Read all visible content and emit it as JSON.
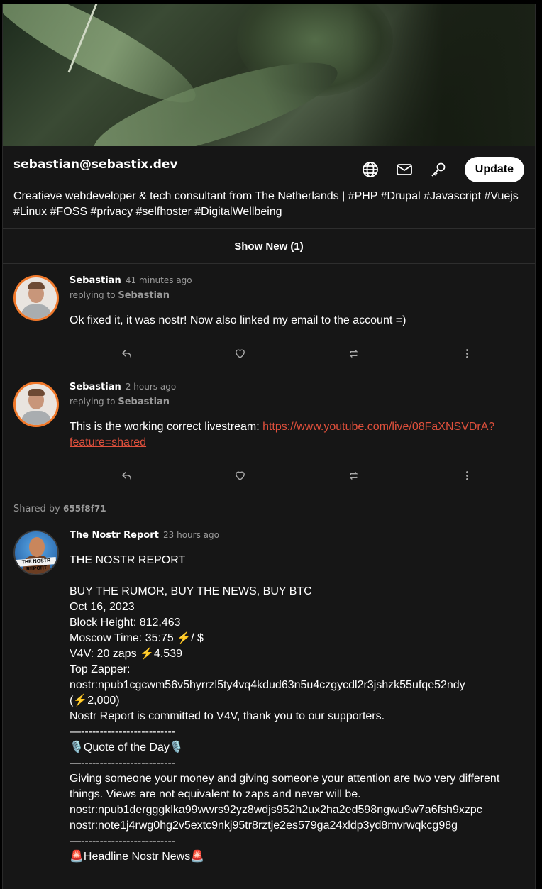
{
  "profile": {
    "name": "sebastian@sebastix.dev",
    "bio": "Creatieve webdeveloper & tech consultant from The Netherlands | #PHP #Drupal #Javascript #Vuejs #Linux #FOSS #privacy #selfhoster #DigitalWellbeing",
    "update_label": "Update",
    "icons": [
      "globe-icon",
      "mail-icon",
      "key-icon"
    ]
  },
  "feed": {
    "show_new_label": "Show New (1)",
    "notes": [
      {
        "author": "Sebastian",
        "time": "41 minutes ago",
        "replying_prefix": "replying to",
        "replying_to": "Sebastian",
        "text": "Ok fixed it, it was nostr! Now also linked my email to the account =)"
      },
      {
        "author": "Sebastian",
        "time": "2 hours ago",
        "replying_prefix": "replying to",
        "replying_to": "Sebastian",
        "text": "This is the working correct livestream: ",
        "link": "https://www.youtube.com/live/08FaXNSVDrA?feature=shared"
      }
    ],
    "repost": {
      "shared_prefix": "Shared by",
      "shared_by": "655f8f71",
      "author": "The Nostr Report",
      "time": "23 hours ago",
      "avatar_badge": "THE NOSTR REPORT",
      "text": "THE NOSTR REPORT\n\nBUY THE RUMOR, BUY THE NEWS, BUY BTC\nOct 16, 2023\nBlock Height: 812,463\nMoscow Time: 35:75 ⚡️/ $\nV4V: 20 zaps ⚡️4,539\nTop Zapper:\nnostr:npub1cgcwm56v5hyrrzl5ty4vq4kdud63n5u4czgycdl2r3jshzk55ufqe52ndy\n(⚡️2,000)\nNostr Report is committed to V4V, thank you to our supporters.\n—-------------------------\n🎙️Quote of the Day🎙️\n—-------------------------\nGiving someone your money and giving someone your attention are two very different things. Views are not equivalent to zaps and never will be.\nnostr:npub1dergggklka99wwrs92yz8wdjs952h2ux2ha2ed598ngwu9w7a6fsh9xzpc\nnostr:note1j4rwg0hg2v5extc9nkj95tr8rztje2es579ga24xldp3yd8mvrwqkcg98g\n—-------------------------\n🚨Headline Nostr News🚨"
    }
  },
  "colors": {
    "accent": "#f0782a",
    "link": "#e0503c",
    "background": "#161616",
    "muted": "#9a9a9a"
  }
}
